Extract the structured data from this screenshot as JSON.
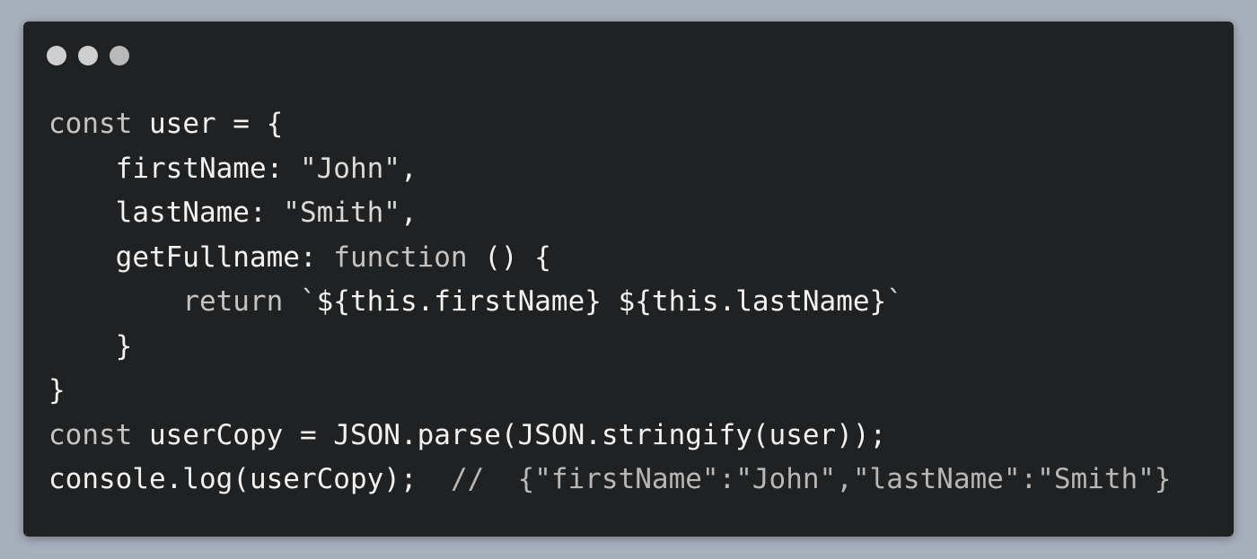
{
  "window": {
    "controls": [
      {
        "name": "close",
        "color": "#cfcfcf"
      },
      {
        "name": "minimize",
        "color": "#cfcfcf"
      },
      {
        "name": "maximize",
        "color": "#b9b9b9"
      }
    ]
  },
  "code": {
    "lines": [
      {
        "tokens": [
          {
            "t": "kw",
            "text": "const"
          },
          {
            "t": "pl",
            "text": " user = {"
          }
        ]
      },
      {
        "tokens": [
          {
            "t": "pl",
            "text": "    firstName: "
          },
          {
            "t": "str",
            "text": "\"John\""
          },
          {
            "t": "pl",
            "text": ","
          }
        ]
      },
      {
        "tokens": [
          {
            "t": "pl",
            "text": "    lastName: "
          },
          {
            "t": "str",
            "text": "\"Smith\""
          },
          {
            "t": "pl",
            "text": ","
          }
        ]
      },
      {
        "tokens": [
          {
            "t": "pl",
            "text": "    getFullname: "
          },
          {
            "t": "kw",
            "text": "function"
          },
          {
            "t": "pl",
            "text": " () {"
          }
        ]
      },
      {
        "tokens": [
          {
            "t": "pl",
            "text": "        "
          },
          {
            "t": "kw",
            "text": "return"
          },
          {
            "t": "pl",
            "text": " "
          },
          {
            "t": "str",
            "text": "`"
          },
          {
            "t": "pl",
            "text": "${this.firstName} ${this.lastName}"
          },
          {
            "t": "str",
            "text": "`"
          }
        ]
      },
      {
        "tokens": [
          {
            "t": "pl",
            "text": "    }"
          }
        ]
      },
      {
        "tokens": [
          {
            "t": "pl",
            "text": "}"
          }
        ]
      },
      {
        "tokens": [
          {
            "t": "kw",
            "text": "const"
          },
          {
            "t": "pl",
            "text": " userCopy = JSON.parse(JSON.stringify(user));"
          }
        ]
      },
      {
        "tokens": [
          {
            "t": "pl",
            "text": "console.log(userCopy);  "
          },
          {
            "t": "cm",
            "text": "//  {\"firstName\":\"John\",\"lastName\":\"Smith\"}"
          }
        ]
      }
    ]
  }
}
